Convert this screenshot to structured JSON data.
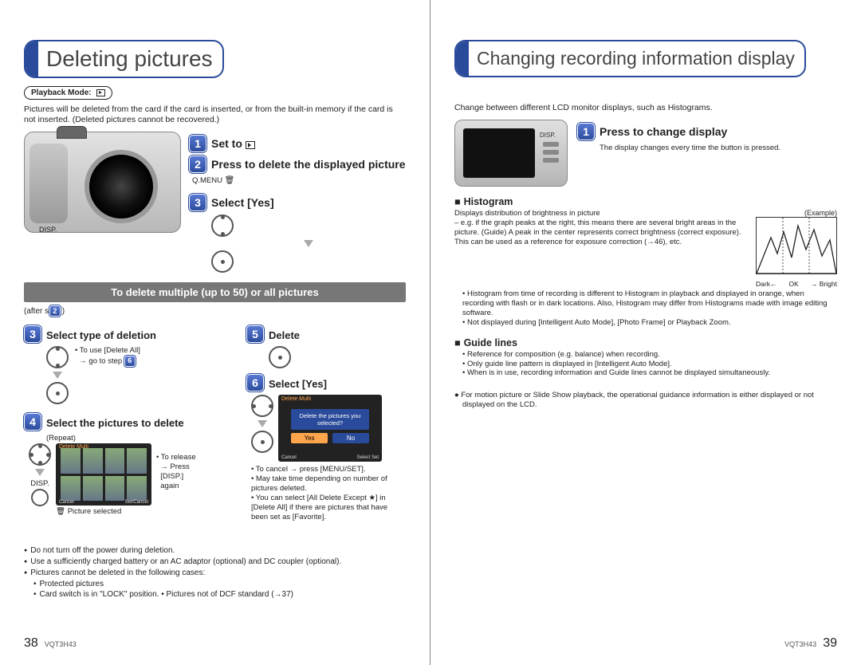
{
  "left": {
    "title": "Deleting pictures",
    "playback_mode": "Playback Mode:",
    "intro": "Pictures will be deleted from the card if the card is inserted, or from the built-in memory if the card is not inserted. (Deleted pictures cannot be recovered.)",
    "disp_label": "DISP.",
    "qmenu_label": "Q.MENU",
    "step1": "Set to",
    "step2": "Press to delete the displayed picture",
    "step3": "Select [Yes]",
    "banner": "To delete multiple (up to 50) or all pictures",
    "after_step": "(after step      )",
    "s3_label": "Select type of deletion",
    "s3_b1": "To use [Delete All]",
    "s3_b2": "→ go to step",
    "s4_label": "Select the pictures to delete",
    "s4_repeat": "(Repeat)",
    "s4_disp": "DISP.",
    "s4_release1": "To release",
    "s4_release2": "→ Press",
    "s4_release3": "  [DISP.]",
    "s4_release4": "  again",
    "s4_picsel": "Picture selected",
    "scr_hdr": "Delete Multi",
    "scr_cancel": "Cancel",
    "scr_set": "Set/Cancel",
    "scr_select": "Select OK",
    "s5_label": "Delete",
    "s6_label": "Select [Yes]",
    "dlg_hdr": "Delete Multi",
    "dlg_q": "Delete the pictures you selected?",
    "dlg_yes": "Yes",
    "dlg_no": "No",
    "dlg_cancel": "Cancel",
    "dlg_set": "Select Set",
    "s6_b1": "To cancel → press [MENU/SET].",
    "s6_b2": "May take time depending on number of pictures deleted.",
    "s6_b3": "You can select [All Delete Except ★] in [Delete All] if there are pictures that have been set as [Favorite].",
    "n1": "Do not turn off the power during deletion.",
    "n2": "Use a sufficiently charged battery or an AC adaptor (optional) and DC coupler (optional).",
    "n3": "Pictures cannot be deleted in the following cases:",
    "n3a": "Protected pictures",
    "n3b": "Card switch is in \"LOCK\" position. • Pictures not of DCF standard (→37)",
    "doc_id": "VQT3H43",
    "page_num": "38"
  },
  "right": {
    "title": "Changing recording information display",
    "intro": "Change between different LCD monitor displays, such as Histograms.",
    "cam_disp": "DISP.",
    "step1": "Press to change display",
    "step1_body": "The display changes every time the button is pressed.",
    "hist_title": "Histogram",
    "hist_p1": "Displays distribution of brightness in picture\n– e.g. if the graph peaks at the right, this means there are several bright areas in the picture. (Guide) A peak in the center represents correct brightness (correct exposure). This can be used as a reference for exposure correction (→46), etc.",
    "hist_b1": "Histogram from time of recording is different to Histogram in playback and displayed in orange, when recording with flash or in dark locations. Also, Histogram may differ from Histograms made with image editing software.",
    "hist_b2": "Not displayed during      [Intelligent Auto Mode], [Photo Frame] or Playback Zoom.",
    "example": "(Example)",
    "dark": "Dark←",
    "ok": "OK",
    "bright": "→ Bright",
    "guide_title": "Guide lines",
    "guide_b1": "Reference for composition (e.g. balance) when recording.",
    "guide_b2": "Only guide line pattern      is displayed in [Intelligent Auto Mode].",
    "guide_b3": "When      is in use, recording information and Guide lines cannot be displayed simultaneously.",
    "motion_note": "For motion picture or Slide Show playback, the operational guidance information is either displayed or not displayed on the LCD.",
    "doc_id": "VQT3H43",
    "page_num": "39"
  }
}
